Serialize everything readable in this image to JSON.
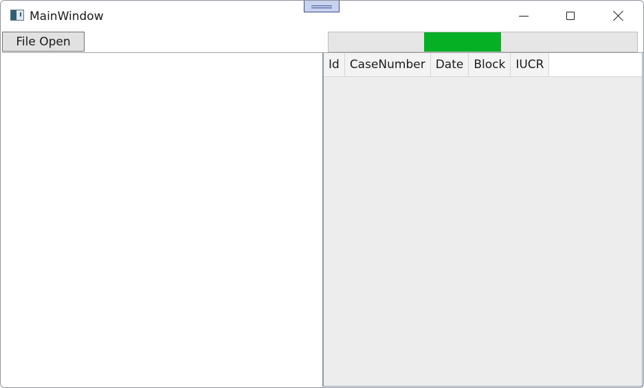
{
  "window": {
    "title": "MainWindow",
    "icon": "app-window-icon"
  },
  "toolbar": {
    "file_open_label": "File Open"
  },
  "progress": {
    "mode": "indeterminate",
    "indicator_start_fraction": 0.31,
    "indicator_end_fraction": 0.56,
    "indicator_color": "#06b025",
    "track_color": "#e6e6e6"
  },
  "data_grid": {
    "columns": [
      "Id",
      "CaseNumber",
      "Date",
      "Block",
      "IUCR"
    ],
    "rows": []
  },
  "caption_buttons": {
    "minimize": "minimize-icon",
    "maximize": "maximize-icon",
    "close": "close-icon"
  }
}
